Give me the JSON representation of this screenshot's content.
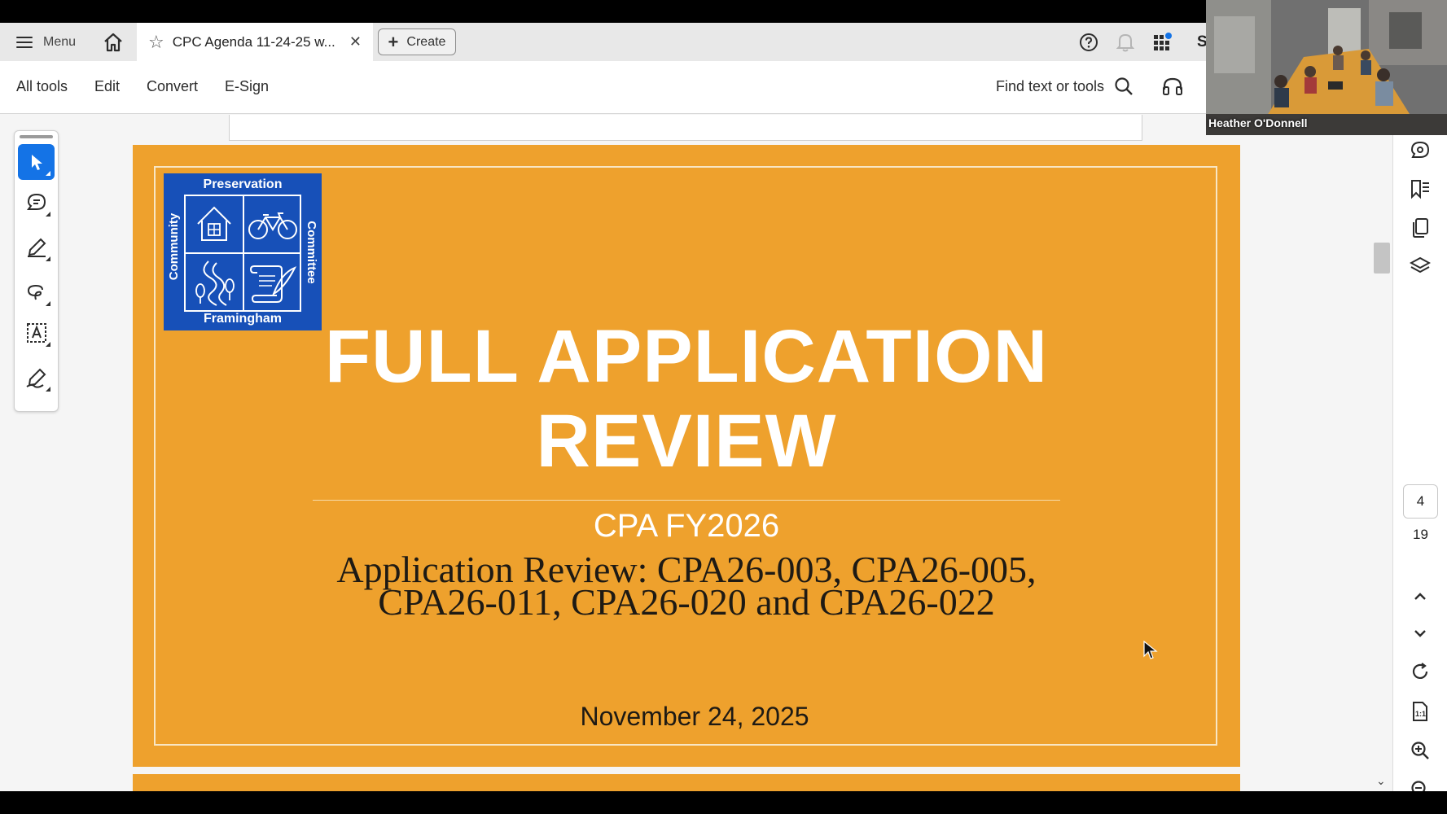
{
  "tabbar": {
    "menu_label": "Menu",
    "doc_tab_title": "CPC Agenda 11-24-25 w...",
    "create_label": "Create",
    "account_initial": "S"
  },
  "toolbar": {
    "all_tools": "All tools",
    "edit": "Edit",
    "convert": "Convert",
    "esign": "E-Sign",
    "find_label": "Find text or tools"
  },
  "left_rail": {
    "tools": [
      "select-tool-icon",
      "comment-tool-icon",
      "highlight-tool-icon",
      "draw-tool-icon",
      "text-select-tool-icon",
      "sign-tool-icon"
    ],
    "active_tool": "select-tool-icon"
  },
  "slide": {
    "logo": {
      "top": "Preservation",
      "bottom": "Framingham",
      "left": "Community",
      "right": "Committee"
    },
    "title": "FULL APPLICATION REVIEW",
    "subtitle": "CPA FY2026",
    "applications_line1": "Application Review: CPA26-003, CPA26-005,",
    "applications_line2": "CPA26-011, CPA26-020 and CPA26-022",
    "date": "November 24, 2025",
    "background_color": "#eea12d",
    "logo_color": "#1750b8"
  },
  "page_nav": {
    "current_page": "4",
    "total_pages": "19"
  },
  "video": {
    "participant_name": "Heather O'Donnell"
  },
  "colors": {
    "accent": "#1473e6"
  }
}
